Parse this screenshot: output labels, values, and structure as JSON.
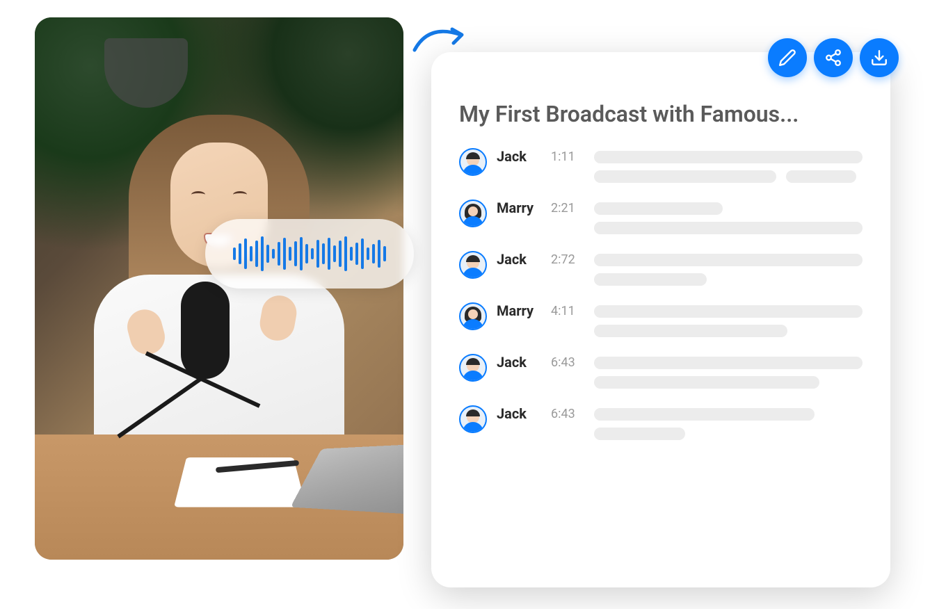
{
  "colors": {
    "primary": "#0a7cff",
    "placeholder": "#ececec"
  },
  "actions": {
    "edit": "edit",
    "share": "share",
    "download": "download"
  },
  "transcript": {
    "title": "My First Broadcast with Famous...",
    "entries": [
      {
        "speaker": "Jack",
        "avatar": "male",
        "time": "1:11"
      },
      {
        "speaker": "Marry",
        "avatar": "female",
        "time": "2:21"
      },
      {
        "speaker": "Jack",
        "avatar": "male",
        "time": "2:72"
      },
      {
        "speaker": "Marry",
        "avatar": "female",
        "time": "4:11"
      },
      {
        "speaker": "Jack",
        "avatar": "male",
        "time": "6:43"
      },
      {
        "speaker": "Jack",
        "avatar": "male",
        "time": "6:43"
      }
    ]
  }
}
